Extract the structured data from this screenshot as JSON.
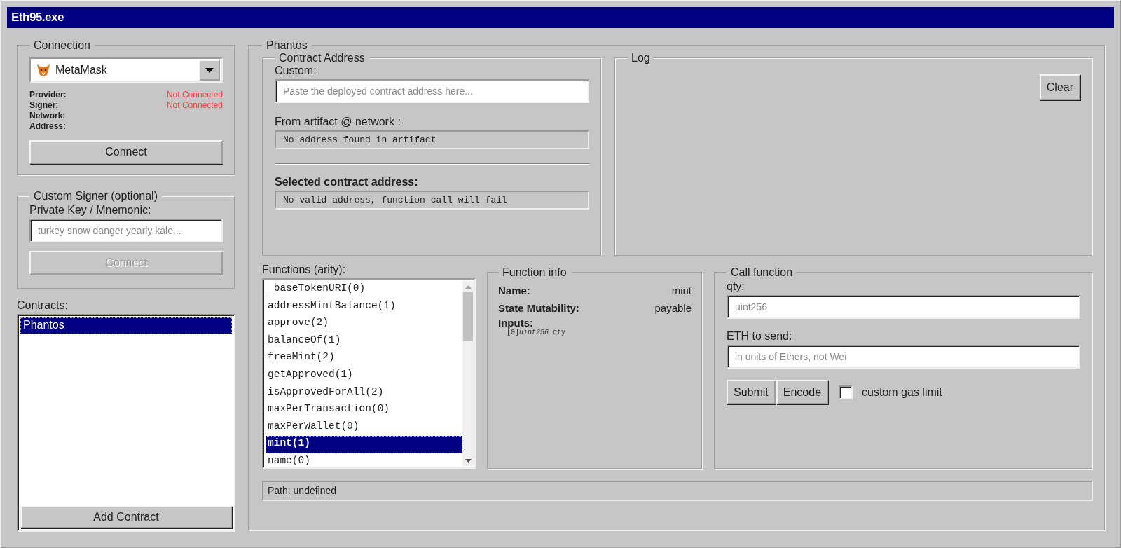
{
  "window": {
    "title": "Eth95.exe"
  },
  "connection": {
    "title": "Connection",
    "provider_select": {
      "value": "MetaMask"
    },
    "status": [
      {
        "label": "Provider:",
        "value": "Not Connected"
      },
      {
        "label": "Signer:",
        "value": "Not Connected"
      },
      {
        "label": "Network:"
      },
      {
        "label": "Address:"
      }
    ],
    "connect_button": {
      "label": "Connect",
      "disabled": false
    }
  },
  "custom_signer": {
    "title": "Custom Signer (optional)",
    "field_label": "Private Key / Mnemonic:",
    "placeholder": "turkey snow danger yearly kale...",
    "connect_button": {
      "label": "Connect",
      "disabled": true
    }
  },
  "contracts": {
    "label": "Contracts:",
    "items": [
      {
        "name": "Phantos",
        "selected": true
      }
    ],
    "add_button": "Add Contract"
  },
  "contract_panel": {
    "title": "Phantos",
    "contract_address": {
      "title": "Contract Address",
      "custom_label": "Custom:",
      "custom_placeholder": "Paste the deployed contract address here...",
      "artifact_label": "From artifact @ network :",
      "artifact_value": "No address found in artifact",
      "selected_label": "Selected contract address:",
      "selected_value": "No valid address, function call will fail"
    },
    "log": {
      "title": "Log",
      "clear_button": "Clear"
    },
    "functions": {
      "label": "Functions (arity):",
      "items": [
        {
          "name": "_baseTokenURI(0)",
          "selected": false
        },
        {
          "name": "addressMintBalance(1)",
          "selected": false
        },
        {
          "name": "approve(2)",
          "selected": false
        },
        {
          "name": "balanceOf(1)",
          "selected": false
        },
        {
          "name": "freeMint(2)",
          "selected": false
        },
        {
          "name": "getApproved(1)",
          "selected": false
        },
        {
          "name": "isApprovedForAll(2)",
          "selected": false
        },
        {
          "name": "maxPerTransaction(0)",
          "selected": false
        },
        {
          "name": "maxPerWallet(0)",
          "selected": false
        },
        {
          "name": "mint(1)",
          "selected": true
        },
        {
          "name": "name(0)",
          "selected": false
        }
      ]
    },
    "function_info": {
      "title": "Function info",
      "rows": [
        {
          "label": "Name:",
          "value": "mint"
        },
        {
          "label": "State Mutability:",
          "value": "payable"
        }
      ],
      "inputs_label": "Inputs:",
      "inputs": [
        "[0]*uint256* qty"
      ]
    },
    "call_function": {
      "title": "Call function",
      "fields": [
        {
          "label": "qty:",
          "placeholder": "uint256"
        },
        {
          "label": "ETH to send:",
          "placeholder": "in units of Ethers, not Wei"
        }
      ],
      "buttons": [
        "Submit",
        "Encode"
      ],
      "gas_checkbox": {
        "label": "custom gas limit",
        "checked": false
      }
    },
    "path": "Path: undefined"
  }
}
